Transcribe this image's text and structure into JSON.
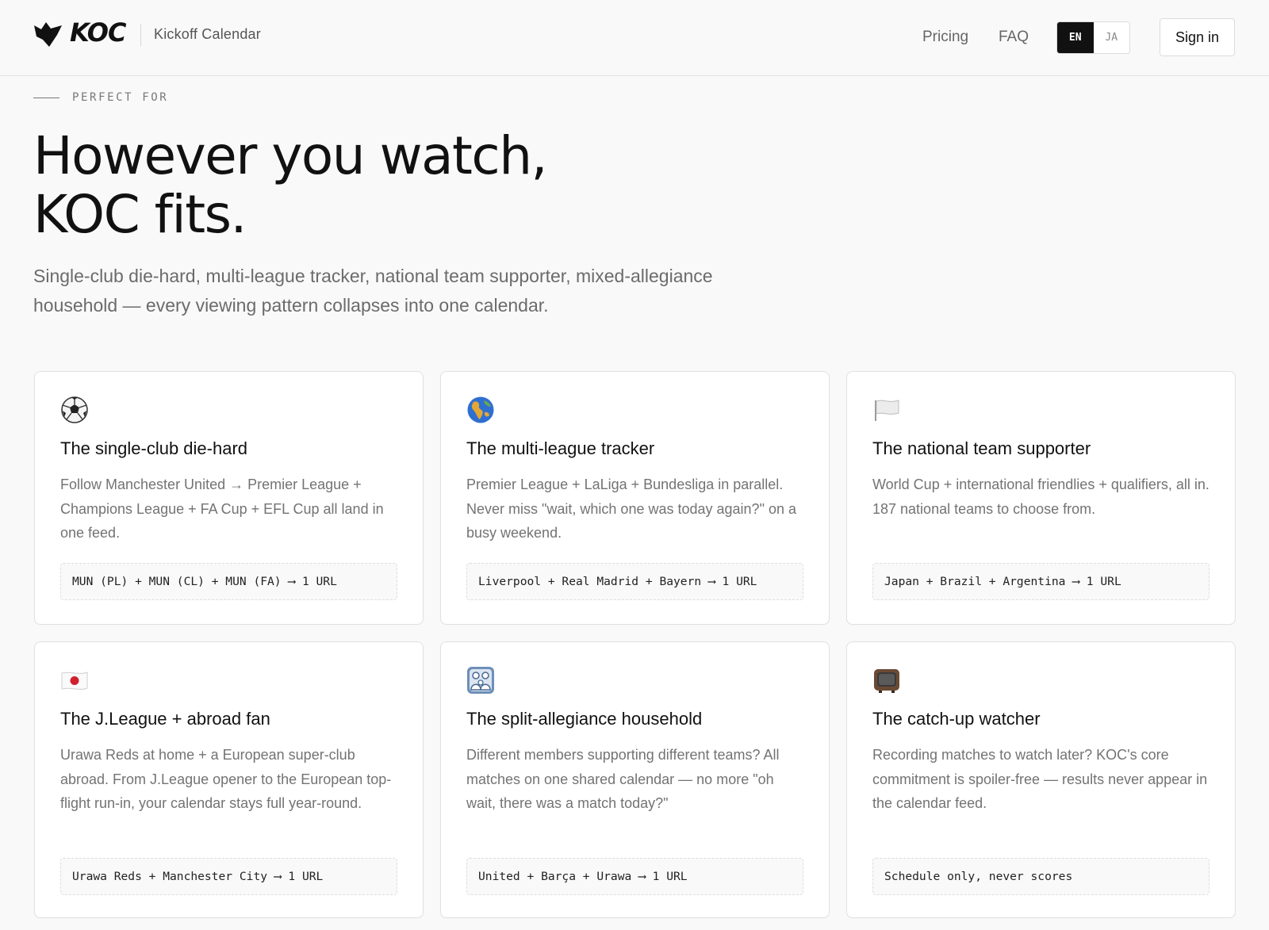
{
  "header": {
    "logo_text": "KOC",
    "brand_name": "Kickoff Calendar",
    "nav": {
      "pricing": "Pricing",
      "faq": "FAQ"
    },
    "lang": {
      "en": "EN",
      "ja": "JA",
      "active": "EN"
    },
    "signin": "Sign in"
  },
  "hero": {
    "eyebrow": "PERFECT FOR",
    "headline_line1": "However you watch,",
    "headline_line2": "KOC fits.",
    "subtitle": "Single-club die-hard, multi-league tracker, national team supporter, mixed-allegiance household — every viewing pattern collapses into one calendar."
  },
  "cards": [
    {
      "icon": "soccer-ball-icon",
      "title": "The single-club die-hard",
      "desc": "Follow Manchester United → Premier League + Champions League + FA Cup + EFL Cup all land in one feed.",
      "code": "MUN (PL) + MUN (CL) + MUN (FA) ⟶ 1 URL"
    },
    {
      "icon": "globe-icon",
      "title": "The multi-league tracker",
      "desc": "Premier League + LaLiga + Bundesliga in parallel. Never miss \"wait, which one was today again?\" on a busy weekend.",
      "code": "Liverpool + Real Madrid + Bayern ⟶ 1 URL"
    },
    {
      "icon": "white-flag-icon",
      "title": "The national team supporter",
      "desc": "World Cup + international friendlies + qualifiers, all in. 187 national teams to choose from.",
      "code": "Japan + Brazil + Argentina ⟶ 1 URL"
    },
    {
      "icon": "japan-flag-icon",
      "title": "The J.League + abroad fan",
      "desc": "Urawa Reds at home + a European super-club abroad. From J.League opener to the European top-flight run-in, your calendar stays full year-round.",
      "code": "Urawa Reds + Manchester City ⟶ 1 URL"
    },
    {
      "icon": "family-icon",
      "title": "The split-allegiance household",
      "desc": "Different members supporting different teams? All matches on one shared calendar — no more \"oh wait, there was a match today?\"",
      "code": "United + Barça + Urawa ⟶ 1 URL"
    },
    {
      "icon": "television-icon",
      "title": "The catch-up watcher",
      "desc": "Recording matches to watch later? KOC's core commitment is spoiler-free — results never appear in the calendar feed.",
      "code": "Schedule only, never scores"
    }
  ]
}
